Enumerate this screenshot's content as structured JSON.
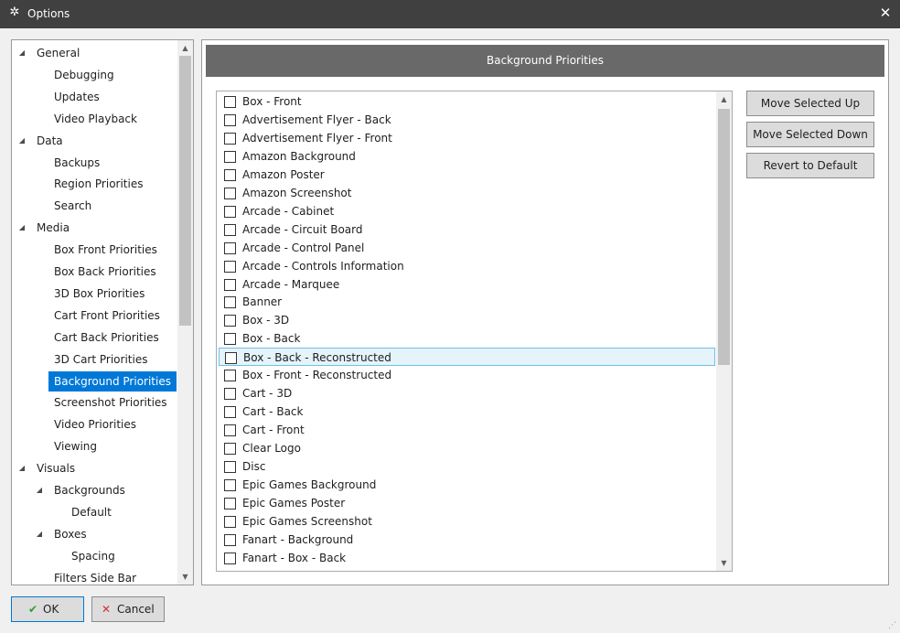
{
  "window": {
    "title": "Options",
    "icon": "gear-icon",
    "close_icon": "close-icon"
  },
  "tree": {
    "items": [
      {
        "label": "General",
        "level": 0,
        "expanded": true
      },
      {
        "label": "Debugging",
        "level": 1
      },
      {
        "label": "Updates",
        "level": 1
      },
      {
        "label": "Video Playback",
        "level": 1
      },
      {
        "label": "Data",
        "level": 0,
        "expanded": true
      },
      {
        "label": "Backups",
        "level": 1
      },
      {
        "label": "Region Priorities",
        "level": 1
      },
      {
        "label": "Search",
        "level": 1
      },
      {
        "label": "Media",
        "level": 0,
        "expanded": true
      },
      {
        "label": "Box Front Priorities",
        "level": 1
      },
      {
        "label": "Box Back Priorities",
        "level": 1
      },
      {
        "label": "3D Box Priorities",
        "level": 1
      },
      {
        "label": "Cart Front Priorities",
        "level": 1
      },
      {
        "label": "Cart Back Priorities",
        "level": 1
      },
      {
        "label": "3D Cart Priorities",
        "level": 1
      },
      {
        "label": "Background Priorities",
        "level": 1,
        "selected": true
      },
      {
        "label": "Screenshot Priorities",
        "level": 1
      },
      {
        "label": "Video Priorities",
        "level": 1
      },
      {
        "label": "Viewing",
        "level": 1
      },
      {
        "label": "Visuals",
        "level": 0,
        "expanded": true
      },
      {
        "label": "Backgrounds",
        "level": 1,
        "expanded": true
      },
      {
        "label": "Default",
        "level": 2
      },
      {
        "label": "Boxes",
        "level": 1,
        "expanded": true
      },
      {
        "label": "Spacing",
        "level": 2
      },
      {
        "label": "Filters Side Bar",
        "level": 1
      }
    ]
  },
  "panel": {
    "header": "Background Priorities",
    "list": [
      {
        "label": "Box - Front",
        "checked": false
      },
      {
        "label": "Advertisement Flyer - Back",
        "checked": false
      },
      {
        "label": "Advertisement Flyer - Front",
        "checked": false
      },
      {
        "label": "Amazon Background",
        "checked": false
      },
      {
        "label": "Amazon Poster",
        "checked": false
      },
      {
        "label": "Amazon Screenshot",
        "checked": false
      },
      {
        "label": "Arcade - Cabinet",
        "checked": false
      },
      {
        "label": "Arcade - Circuit Board",
        "checked": false
      },
      {
        "label": "Arcade - Control Panel",
        "checked": false
      },
      {
        "label": "Arcade - Controls Information",
        "checked": false
      },
      {
        "label": "Arcade - Marquee",
        "checked": false
      },
      {
        "label": "Banner",
        "checked": false
      },
      {
        "label": "Box - 3D",
        "checked": false
      },
      {
        "label": "Box - Back",
        "checked": false
      },
      {
        "label": "Box - Back - Reconstructed",
        "checked": false,
        "highlighted": true
      },
      {
        "label": "Box - Front - Reconstructed",
        "checked": false
      },
      {
        "label": "Cart - 3D",
        "checked": false
      },
      {
        "label": "Cart - Back",
        "checked": false
      },
      {
        "label": "Cart - Front",
        "checked": false
      },
      {
        "label": "Clear Logo",
        "checked": false
      },
      {
        "label": "Disc",
        "checked": false
      },
      {
        "label": "Epic Games Background",
        "checked": false
      },
      {
        "label": "Epic Games Poster",
        "checked": false
      },
      {
        "label": "Epic Games Screenshot",
        "checked": false
      },
      {
        "label": "Fanart - Background",
        "checked": false
      },
      {
        "label": "Fanart - Box - Back",
        "checked": false
      }
    ],
    "buttons": {
      "move_up": "Move Selected Up",
      "move_down": "Move Selected Down",
      "revert": "Revert to Default"
    }
  },
  "footer": {
    "ok": "OK",
    "cancel": "Cancel"
  },
  "colors": {
    "titlebar": "#404040",
    "selection": "#0078d7",
    "header": "#696969",
    "highlight": "#e5f3fb"
  }
}
